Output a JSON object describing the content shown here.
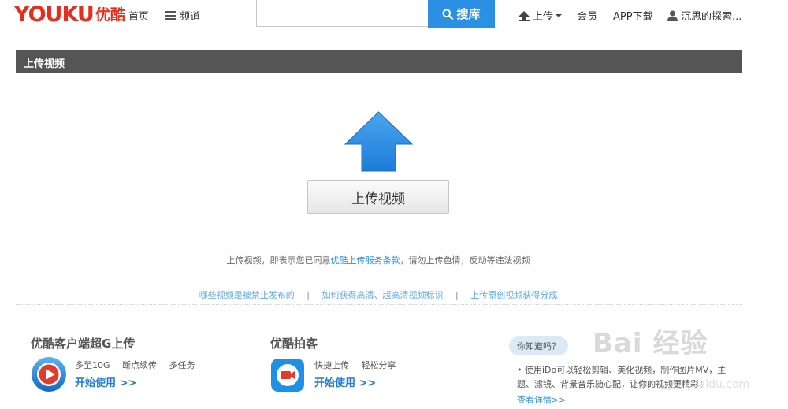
{
  "header": {
    "logo_text": "YOUKU",
    "logo_cn": "优酷",
    "nav_home": "首页",
    "nav_channel": "频道",
    "search_placeholder": "",
    "search_button": "搜库",
    "upload": "上传",
    "vip": "会员",
    "app_download": "APP下载",
    "user": "沉思的探索..."
  },
  "title_bar": "上传视频",
  "upload_button": "上传视频",
  "agreement": {
    "prefix": "上传视频，即表示您已同意",
    "link": "优酷上传服务条款",
    "suffix": "，请勿上传色情，反动等违法视频"
  },
  "help_links": [
    "哪些视频是被禁止发布的",
    "如何获得高清、超高清视频标识",
    "上传原创视频获得分成"
  ],
  "help_separator": "|",
  "client": {
    "title": "优酷客户端超G上传",
    "features": [
      "多至10G",
      "断点续传",
      "多任务"
    ],
    "start": "开始使用 >>"
  },
  "phone": {
    "title": "优酷拍客",
    "features": [
      "快捷上传",
      "轻松分享"
    ],
    "start": "开始使用 >>"
  },
  "tip": {
    "bubble": "你知道吗？",
    "text": "• 使用iDo可以轻松剪辑、美化视频，制作图片MV，主题、滤镜、背景音乐随心配，让你的视频更精彩！",
    "more": "查看详情>>"
  },
  "watermark": {
    "main": "Bai 经验",
    "sub": "jingyan.baidu.com"
  },
  "colors": {
    "brand_red": "#e62e1e",
    "accent_blue": "#2a90e4",
    "title_bar": "#555555"
  },
  "icons": [
    "hamburger-icon",
    "search-icon",
    "upload-icon",
    "caret-down-icon",
    "user-icon",
    "big-upload-arrow-icon",
    "youku-client-icon",
    "youku-paike-icon"
  ]
}
